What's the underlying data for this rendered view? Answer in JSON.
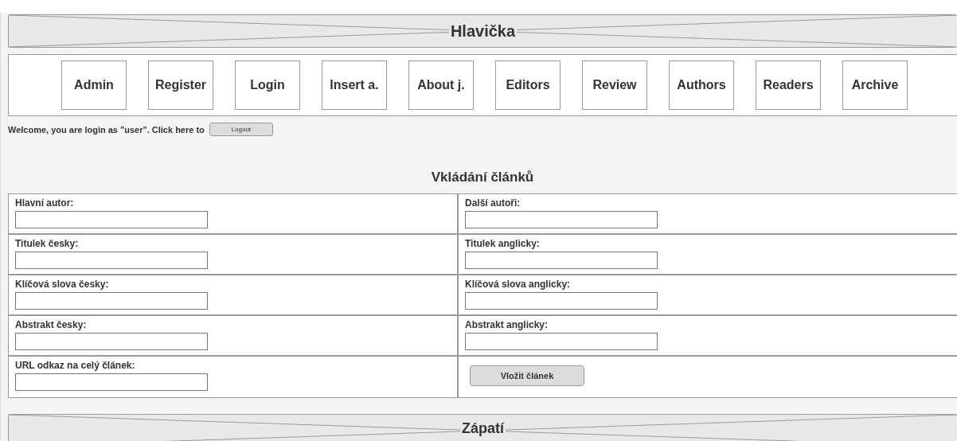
{
  "header": {
    "title": "Hlavička"
  },
  "nav": {
    "items": [
      "Admin",
      "Register",
      "Login",
      "Insert a.",
      "About j.",
      "Editors",
      "Review",
      "Authors",
      "Readers",
      "Archive"
    ]
  },
  "welcome": {
    "text": "Welcome, you are login as \"user\". Click here to",
    "button": "Logout"
  },
  "form": {
    "title": "Vkládání článků",
    "rows": [
      [
        {
          "kind": "field",
          "label": "Hlavní autor:"
        },
        {
          "kind": "field",
          "label": "Další autoři:"
        }
      ],
      [
        {
          "kind": "field",
          "label": "Titulek česky:"
        },
        {
          "kind": "field",
          "label": "Titulek anglicky:"
        }
      ],
      [
        {
          "kind": "field",
          "label": "Klíčová slova česky:"
        },
        {
          "kind": "field",
          "label": "Klíčová slova anglicky:"
        }
      ],
      [
        {
          "kind": "field",
          "label": "Abstrakt česky:"
        },
        {
          "kind": "field",
          "label": "Abstrakt anglicky:"
        }
      ],
      [
        {
          "kind": "field",
          "label": "URL odkaz na celý článek:"
        },
        {
          "kind": "button",
          "label": "Vložit článek"
        }
      ]
    ]
  },
  "footer": {
    "title": "Zápatí"
  }
}
